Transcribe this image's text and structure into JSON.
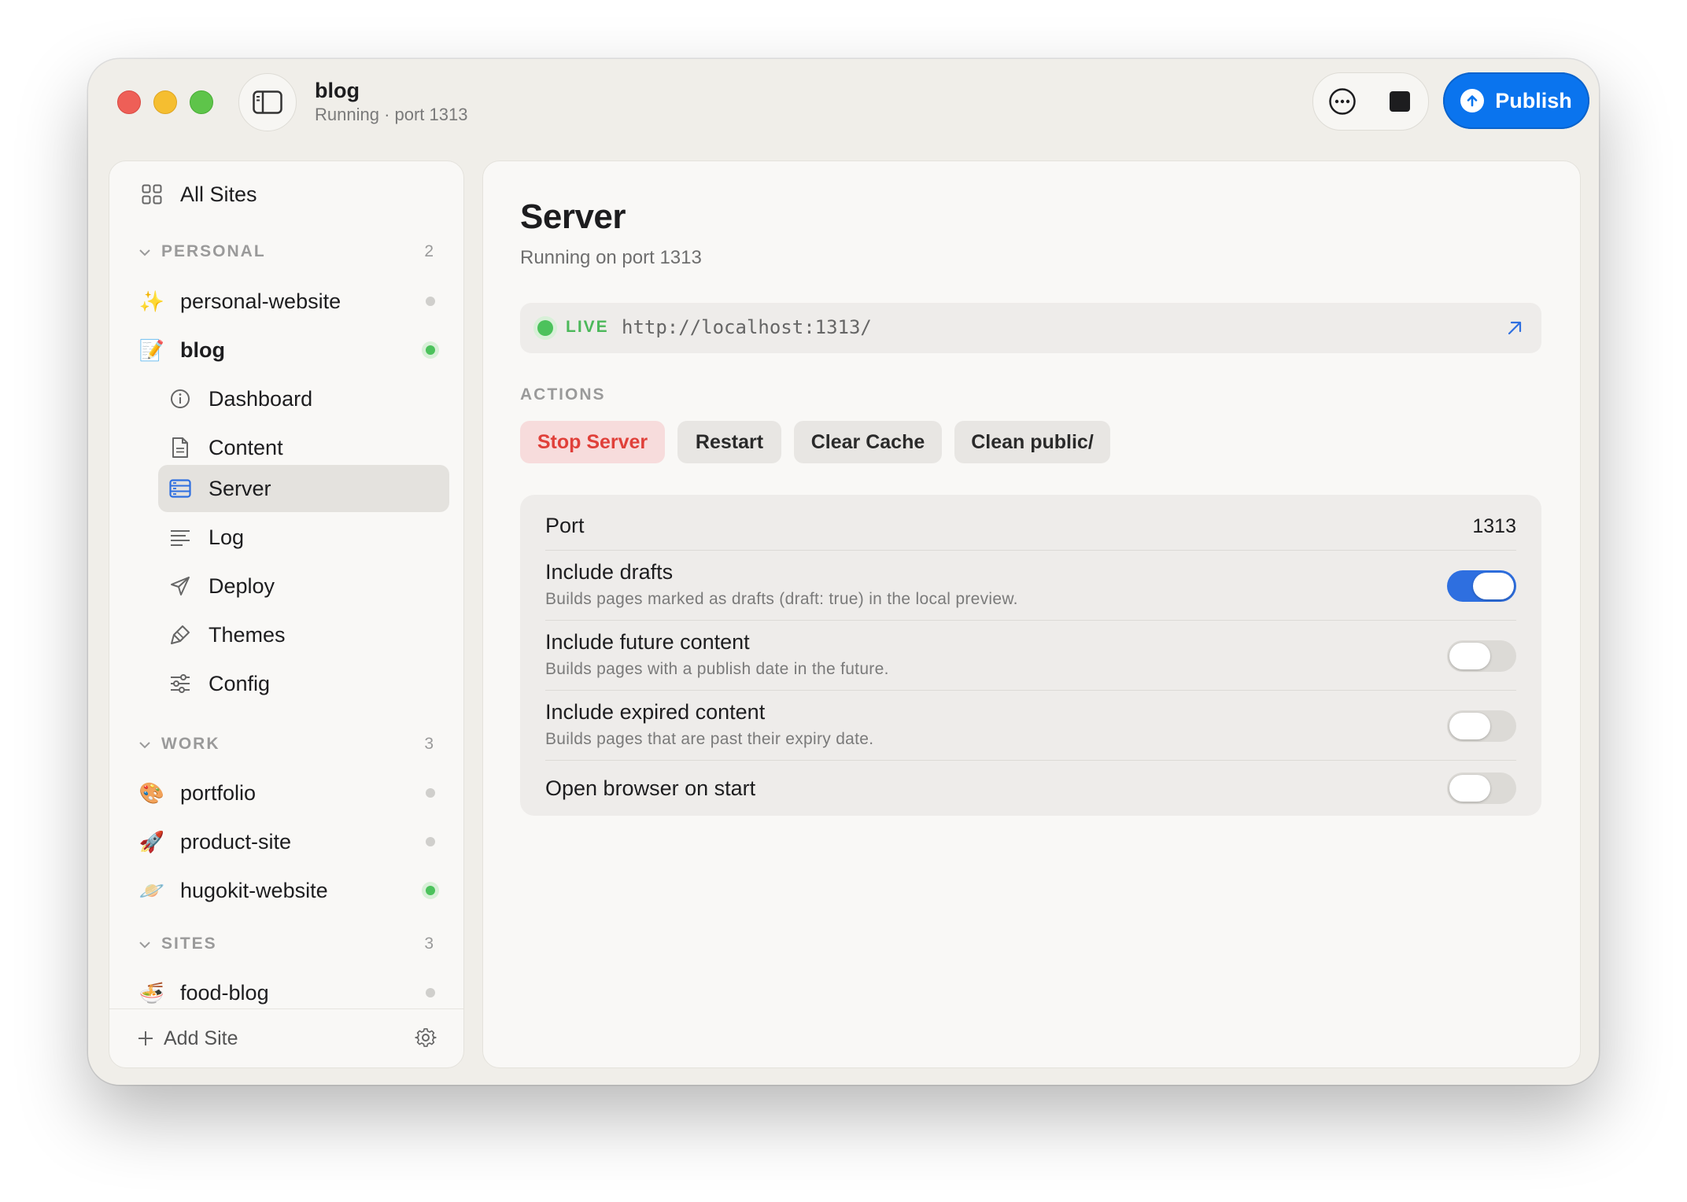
{
  "window": {
    "title": "blog",
    "subtitle": "Running · port 1313"
  },
  "toolbar": {
    "publish_label": "Publish",
    "more_icon": "ellipsis-circle-icon",
    "stop_icon": "stop-icon"
  },
  "sidebar": {
    "all_sites": "All Sites",
    "sections": [
      {
        "label": "PERSONAL",
        "count": "2"
      },
      {
        "label": "WORK",
        "count": "3"
      },
      {
        "label": "SITES",
        "count": "3"
      }
    ],
    "personal_sites": [
      {
        "name": "personal-website",
        "emoji": "✨",
        "status": "idle"
      },
      {
        "name": "blog",
        "emoji": "📝",
        "status": "running"
      }
    ],
    "blog_items": [
      {
        "label": "Dashboard",
        "icon": "info-circle-icon"
      },
      {
        "label": "Content",
        "icon": "document-icon"
      },
      {
        "label": "Server",
        "icon": "server-icon",
        "selected": true
      },
      {
        "label": "Log",
        "icon": "lines-icon"
      },
      {
        "label": "Deploy",
        "icon": "paper-plane-icon"
      },
      {
        "label": "Themes",
        "icon": "paintbrush-icon"
      },
      {
        "label": "Config",
        "icon": "sliders-icon"
      }
    ],
    "work_sites": [
      {
        "name": "portfolio",
        "emoji": "🎨",
        "status": "idle"
      },
      {
        "name": "product-site",
        "emoji": "🚀",
        "status": "idle"
      },
      {
        "name": "hugokit-website",
        "emoji": "🪐",
        "status": "running"
      }
    ],
    "sites": [
      {
        "name": "food-blog",
        "emoji": "🍜",
        "status": "idle"
      }
    ],
    "add_site": "Add Site"
  },
  "main": {
    "title": "Server",
    "subtitle": "Running on port 1313",
    "live_label": "LIVE",
    "url": "http://localhost:1313/",
    "actions_label": "ACTIONS",
    "actions": [
      "Stop Server",
      "Restart",
      "Clear Cache",
      "Clean public/"
    ],
    "settings": {
      "port_label": "Port",
      "port_value": "1313",
      "drafts_title": "Include drafts",
      "drafts_desc": "Builds pages marked as drafts (draft: true) in the local preview.",
      "drafts_on": true,
      "future_title": "Include future content",
      "future_desc": "Builds pages with a publish date in the future.",
      "future_on": false,
      "expired_title": "Include expired content",
      "expired_desc": "Builds pages that are past their expiry date.",
      "expired_on": false,
      "browser_title": "Open browser on start",
      "browser_on": false
    }
  },
  "colors": {
    "accent": "#0a74ee",
    "toggle_on": "#2e6fe0",
    "live_green": "#4cc25c",
    "danger": "#e0403a"
  }
}
